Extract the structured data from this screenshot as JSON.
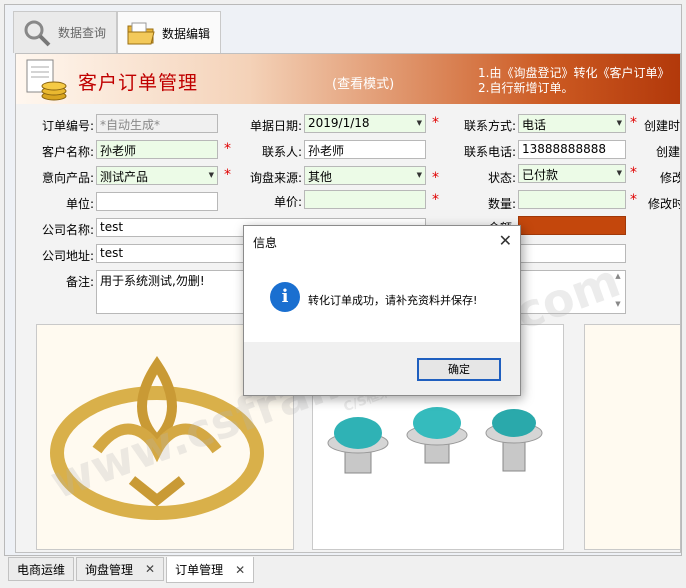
{
  "top_tabs": [
    {
      "label": "数据查询",
      "icon": "magnifier-icon"
    },
    {
      "label": "数据编辑",
      "icon": "folder-icon"
    }
  ],
  "banner": {
    "title": "客户订单管理",
    "mode": "(查看模式)",
    "note1": "1.由《询盘登记》转化《客户订单》",
    "note2": "2.自行新增订单。"
  },
  "form": {
    "order_no": {
      "label": "订单编号:",
      "value": "*自动生成*"
    },
    "doc_date": {
      "label": "单据日期:",
      "value": "2019/1/18"
    },
    "contact_method": {
      "label": "联系方式:",
      "value": "电话"
    },
    "created_time": {
      "label": "创建时"
    },
    "customer_name": {
      "label": "客户名称:",
      "value": "孙老师"
    },
    "contact_person": {
      "label": "联系人:",
      "value": "孙老师"
    },
    "phone": {
      "label": "联系电话:",
      "value": "13888888888"
    },
    "created_by": {
      "label": "创建"
    },
    "product": {
      "label": "意向产品:",
      "value": "测试产品"
    },
    "source": {
      "label": "询盘来源:",
      "value": "其他"
    },
    "status": {
      "label": "状态:",
      "value": "已付款"
    },
    "modified_by": {
      "label": "修改"
    },
    "unit": {
      "label": "单位:",
      "value": ""
    },
    "price": {
      "label": "单价:",
      "value": ""
    },
    "quantity": {
      "label": "数量:",
      "value": ""
    },
    "modified_time": {
      "label": "修改时"
    },
    "company": {
      "label": "公司名称:",
      "value": "test"
    },
    "amount": {
      "label": "金额:"
    },
    "address": {
      "label": "公司地址:",
      "value": "test"
    },
    "remark": {
      "label": "备注:",
      "value": "用于系统测试,勿删!"
    }
  },
  "dialog": {
    "title": "信息",
    "message": "转化订单成功，请补充资料并保存!",
    "ok": "确定"
  },
  "watermark": "www.csframework.com",
  "watermark_sub": "C/S框架网",
  "bottom_tabs": [
    {
      "label": "电商运维"
    },
    {
      "label": "询盘管理"
    },
    {
      "label": "订单管理"
    }
  ],
  "colors": {
    "required": "#e00000",
    "banner_title": "#c00000",
    "accent": "#c4470c",
    "info_icon": "#1a6fd0"
  }
}
